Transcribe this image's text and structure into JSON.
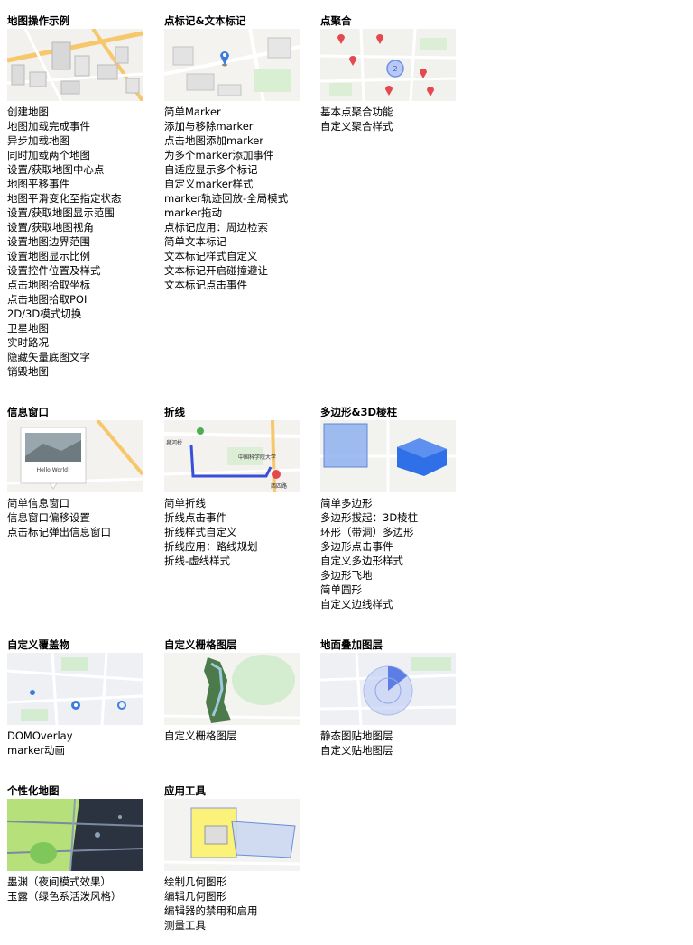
{
  "sections": [
    {
      "id": "map-ops",
      "title": "地图操作示例",
      "items": [
        "创建地图",
        "地图加载完成事件",
        "异步加载地图",
        "同时加载两个地图",
        "设置/获取地图中心点",
        "地图平移事件",
        "地图平滑变化至指定状态",
        "设置/获取地图显示范围",
        "设置/获取地图视角",
        "设置地图边界范围",
        "设置地图显示比例",
        "设置控件位置及样式",
        "点击地图拾取坐标",
        "点击地图拾取POI",
        "2D/3D模式切换",
        "卫星地图",
        "实时路况",
        "隐藏矢量底图文字",
        "销毁地图"
      ]
    },
    {
      "id": "markers",
      "title": "点标记&文本标记",
      "items": [
        "简单Marker",
        "添加与移除marker",
        "点击地图添加marker",
        "为多个marker添加事件",
        "自适应显示多个标记",
        "自定义marker样式",
        "marker轨迹回放-全局模式",
        "marker拖动",
        "点标记应用：周边检索",
        "简单文本标记",
        "文本标记样式自定义",
        "文本标记开启碰撞避让",
        "文本标记点击事件"
      ]
    },
    {
      "id": "cluster",
      "title": "点聚合",
      "items": [
        "基本点聚合功能",
        "自定义聚合样式"
      ]
    },
    {
      "id": "infowin",
      "title": "信息窗口",
      "items": [
        "简单信息窗口",
        "信息窗口偏移设置",
        "点击标记弹出信息窗口"
      ],
      "thumb_text": "Hello World!"
    },
    {
      "id": "polyline",
      "title": "折线",
      "items": [
        "简单折线",
        "折线点击事件",
        "折线样式自定义",
        "折线应用：路线规划",
        "折线-虚线样式"
      ],
      "thumb_text": [
        "泉河桥",
        "中国科学院大学",
        "西四路"
      ]
    },
    {
      "id": "polygon",
      "title": "多边形&3D棱柱",
      "items": [
        "简单多边形",
        "多边形拔起：3D棱柱",
        "环形（带洞）多边形",
        "多边形点击事件",
        "自定义多边形样式",
        "多边形飞地",
        "简单圆形",
        "自定义边线样式"
      ]
    },
    {
      "id": "overlay",
      "title": "自定义覆盖物",
      "items": [
        "DOMOverlay",
        "marker动画"
      ]
    },
    {
      "id": "grid",
      "title": "自定义栅格图层",
      "items": [
        "自定义栅格图层"
      ]
    },
    {
      "id": "ground",
      "title": "地面叠加图层",
      "items": [
        "静态图贴地图层",
        "自定义贴地图层"
      ]
    },
    {
      "id": "style",
      "title": "个性化地图",
      "items": [
        "墨渊（夜间模式效果）",
        "玉露（绿色系活泼风格）"
      ]
    },
    {
      "id": "tools",
      "title": "应用工具",
      "items": [
        "绘制几何图形",
        "编辑几何图形",
        "编辑器的禁用和启用",
        "测量工具"
      ]
    }
  ],
  "colors": {
    "marker_red": "#e5484d",
    "marker_blue": "#3b7ddd",
    "route": "#3a4fd8",
    "polygon_fill": "#8fb2f0",
    "prism": "#2f6fe8",
    "dark_map": "#2b3340",
    "green_map": "#b5e07a",
    "draw_yellow": "#fbf27a"
  }
}
